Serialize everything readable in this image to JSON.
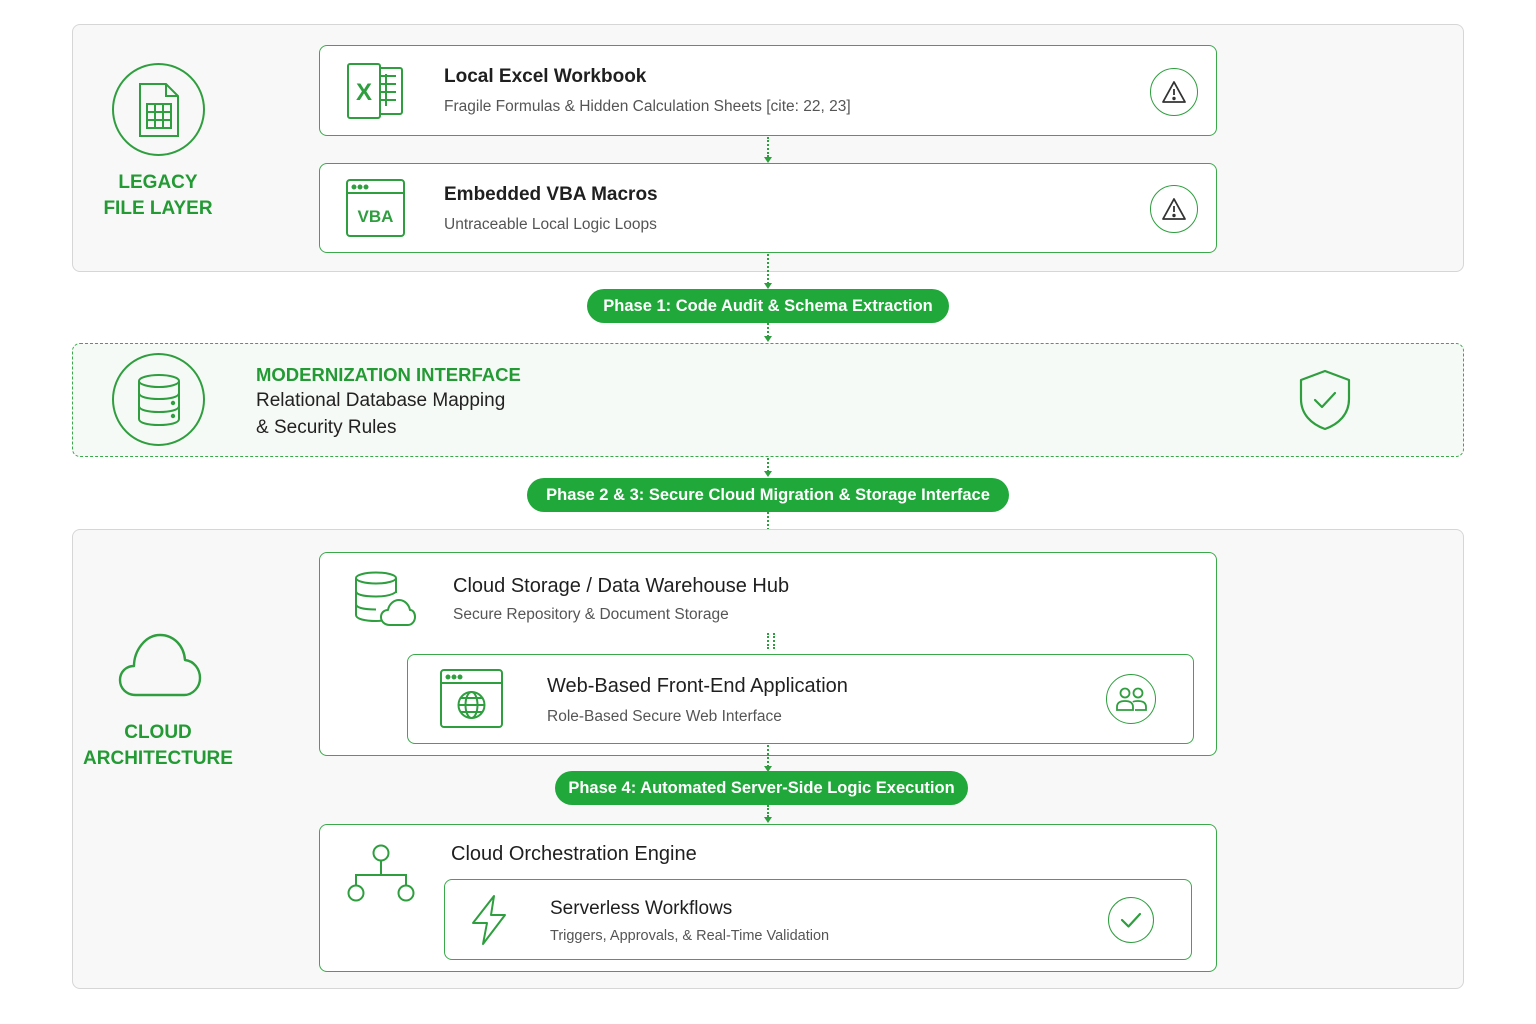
{
  "colors": {
    "accent": "#2e9e3e",
    "pill": "#20a83a",
    "section_bg": "#f8f8f8",
    "section_border": "#d6d6d6"
  },
  "legacy": {
    "label": "LEGACY\nFILE LAYER",
    "icon": "spreadsheet-file-icon",
    "cards": [
      {
        "icon": "excel-icon",
        "icon_text": "X",
        "title": "Local Excel Workbook",
        "subtitle": "Fragile Formulas & Hidden Calculation Sheets [cite: 22, 23]",
        "status_icon": "warning-icon"
      },
      {
        "icon": "vba-window-icon",
        "icon_text": "VBA",
        "title": "Embedded VBA Macros",
        "subtitle": "Untraceable Local Logic Loops",
        "status_icon": "warning-icon"
      }
    ]
  },
  "phases": [
    "Phase 1: Code Audit & Schema Extraction",
    "Phase 2 & 3: Secure Cloud Migration & Storage Interface",
    "Phase 4: Automated Server-Side Logic Execution"
  ],
  "modernization": {
    "icon": "database-icon",
    "title": "MODERNIZATION INTERFACE",
    "line1": "Relational Database Mapping",
    "line2": "& Security Rules",
    "status_icon": "shield-check-icon"
  },
  "cloud": {
    "label": "CLOUD\nARCHITECTURE",
    "icon": "cloud-icon",
    "storage": {
      "icon": "database-cloud-icon",
      "title": "Cloud Storage / Data Warehouse Hub",
      "subtitle": "Secure Repository & Document Storage"
    },
    "webapp": {
      "icon": "browser-globe-icon",
      "title": "Web-Based Front-End Application",
      "subtitle": "Role-Based Secure Web Interface",
      "status_icon": "users-icon"
    },
    "orchestration": {
      "icon": "hierarchy-icon",
      "title": "Cloud Orchestration Engine"
    },
    "serverless": {
      "icon": "lightning-icon",
      "title": "Serverless Workflows",
      "subtitle": "Triggers, Approvals, & Real-Time Validation",
      "status_icon": "check-circle-icon"
    }
  }
}
